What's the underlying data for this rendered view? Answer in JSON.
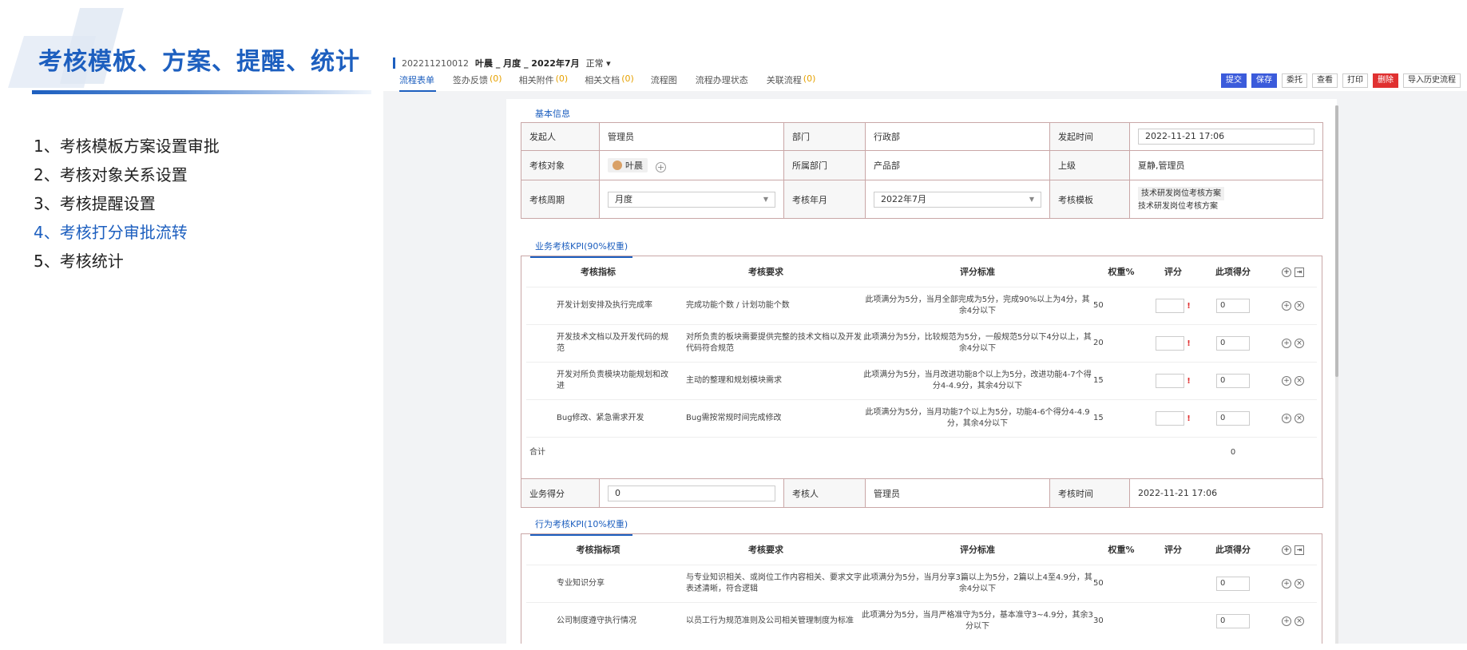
{
  "slide": {
    "title": "考核模板、方案、提醒、统计",
    "outline": [
      {
        "text": "1、考核模板方案设置审批"
      },
      {
        "text": "2、考核对象关系设置"
      },
      {
        "text": "3、考核提醒设置"
      },
      {
        "text": "4、考核打分审批流转"
      },
      {
        "text": "5、考核统计"
      }
    ],
    "active_index": 3,
    "colors": {
      "accent": "#1d5fbf"
    }
  },
  "app": {
    "flow_id": "202211210012",
    "flow_name": "叶晨 _ 月度 _ 2022年7月",
    "flow_status": "正常 ▾",
    "tabs": [
      {
        "label": "流程表单",
        "count": ""
      },
      {
        "label": "签办反馈",
        "count": "(0)"
      },
      {
        "label": "相关附件",
        "count": "(0)"
      },
      {
        "label": "相关文档",
        "count": "(0)"
      },
      {
        "label": "流程图",
        "count": ""
      },
      {
        "label": "流程办理状态",
        "count": ""
      },
      {
        "label": "关联流程",
        "count": "(0)"
      }
    ],
    "actions": [
      "提交",
      "保存",
      "委托",
      "查看",
      "打印",
      "删除",
      "导入历史流程"
    ],
    "basic_tab": "基本信息",
    "basic": {
      "initiator_label": "发起人",
      "initiator": "管理员",
      "dept_label": "部门",
      "dept": "行政部",
      "time_label": "发起时间",
      "time": "2022-11-21 17:06",
      "target_label": "考核对象",
      "target": "叶晨",
      "target_dept_label": "所属部门",
      "target_dept": "产品部",
      "superior_label": "上级",
      "superior": "夏静,管理员",
      "period_label": "考核周期",
      "period": "月度",
      "year_month_label": "考核年月",
      "year_month": "2022年7月",
      "template_label": "考核模板",
      "template_tag": "技术研发岗位考核方案",
      "template_text": "技术研发岗位考核方案"
    },
    "kpi1": {
      "tab": "业务考核KPI(90%权重)",
      "headers": [
        "考核指标",
        "考核要求",
        "评分标准",
        "权重%",
        "评分",
        "此项得分"
      ],
      "rows": [
        {
          "indicator": "开发计划安排及执行完成率",
          "requirement": "完成功能个数 / 计划功能个数",
          "standard": "此项满分为5分，当月全部完成为5分，完成90%以上为4分，其余4分以下",
          "weight": "50",
          "score": "0"
        },
        {
          "indicator": "开发技术文档以及开发代码的规范",
          "requirement": "对所负责的板块需要提供完整的技术文档以及开发代码符合规范",
          "standard": "此项满分为5分，比较规范为5分，一般规范5分以下4分以上，其余4分以下",
          "weight": "20",
          "score": "0"
        },
        {
          "indicator": "开发对所负责模块功能规划和改进",
          "requirement": "主动的整理和规划模块需求",
          "standard": "此项满分为5分，当月改进功能8个以上为5分，改进功能4-7个得分4-4.9分，其余4分以下",
          "weight": "15",
          "score": "0"
        },
        {
          "indicator": "Bug修改、紧急需求开发",
          "requirement": "Bug需按常规时间完成修改",
          "standard": "此项满分为5分，当月功能7个以上为5分，功能4-6个得分4-4.9分，其余4分以下",
          "weight": "15",
          "score": "0"
        }
      ],
      "total_label": "合计",
      "total": "0"
    },
    "summary": {
      "biz_score_label": "业务得分",
      "biz_score": "0",
      "assessor_label": "考核人",
      "assessor": "管理员",
      "assess_time_label": "考核时间",
      "assess_time": "2022-11-21 17:06"
    },
    "kpi2": {
      "tab": "行为考核KPI(10%权重)",
      "headers": [
        "考核指标项",
        "考核要求",
        "评分标准",
        "权重%",
        "评分",
        "此项得分"
      ],
      "rows": [
        {
          "indicator": "专业知识分享",
          "requirement": "与专业知识相关、或岗位工作内容相关、要求文字表述清晰，符合逻辑",
          "standard": "此项满分为5分，当月分享3篇以上为5分，2篇以上4至4.9分，其余4分以下",
          "weight": "50",
          "score": "0"
        },
        {
          "indicator": "公司制度遵守执行情况",
          "requirement": "以员工行为规范准则及公司相关管理制度为标准",
          "standard": "此项满分为5分，当月严格准守为5分，基本准守3~4.9分，其余3分以下",
          "weight": "30",
          "score": "0"
        }
      ]
    }
  }
}
